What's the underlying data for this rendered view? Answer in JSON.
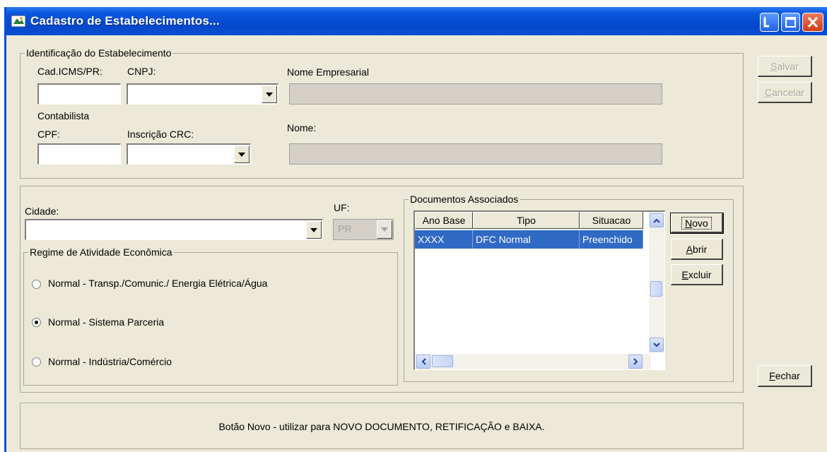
{
  "window": {
    "title": "Cadastro de Estabelecimentos...",
    "title_icon": "app-icon",
    "controls": [
      "minimize-icon",
      "maximize-icon",
      "close-icon"
    ]
  },
  "identificacao": {
    "group_label": "Identificação do Estabelecimento",
    "cad_icms_label": "Cad.ICMS/PR:",
    "cad_icms_value": "",
    "cnpj_label": "CNPJ:",
    "cnpj_value": "",
    "nome_empresarial_label": "Nome Empresarial",
    "nome_empresarial_value": "",
    "contabilista_label": "Contabilista",
    "cpf_label": "CPF:",
    "cpf_value": "",
    "crc_label": "Inscrição CRC:",
    "crc_value": "",
    "nome_label": "Nome:",
    "nome_value": ""
  },
  "localizacao": {
    "cidade_label": "Cidade:",
    "cidade_value": "",
    "uf_label": "UF:",
    "uf_value": "PR"
  },
  "regime": {
    "group_label": "Regime de Atividade Econômica",
    "options": [
      {
        "label": "Normal - Transp./Comunic./ Energia Elétrica/Água",
        "checked": false
      },
      {
        "label": "Normal - Sistema Parceria",
        "checked": true
      },
      {
        "label": "Normal - Indústria/Comércio",
        "checked": false
      }
    ]
  },
  "documentos": {
    "group_label": "Documentos Associados",
    "columns": [
      "Ano Base",
      "Tipo",
      "Situacao"
    ],
    "rows": [
      {
        "ano_base": "XXXX",
        "tipo": "DFC Normal",
        "situacao": "Preenchido",
        "selected": true
      }
    ],
    "buttons": {
      "novo": {
        "prefix": "",
        "underline": "N",
        "rest": "ovo"
      },
      "abrir": {
        "prefix": "",
        "underline": "A",
        "rest": "brir"
      },
      "excluir": {
        "prefix": "",
        "underline": "E",
        "rest": "xcluir"
      }
    }
  },
  "side_buttons": {
    "salvar": {
      "underline": "S",
      "rest": "alvar",
      "enabled": false
    },
    "cancelar": {
      "underline": "C",
      "rest": "ancelar",
      "enabled": false
    },
    "fechar": {
      "underline": "F",
      "rest": "echar",
      "enabled": true
    }
  },
  "hint": {
    "text": "Botão Novo - utilizar para NOVO DOCUMENTO, RETIFICAÇÃO e BAIXA."
  },
  "colors": {
    "titlebar": "#0A58E0",
    "window_bg": "#ECE9D8",
    "selection": "#316AC5"
  }
}
